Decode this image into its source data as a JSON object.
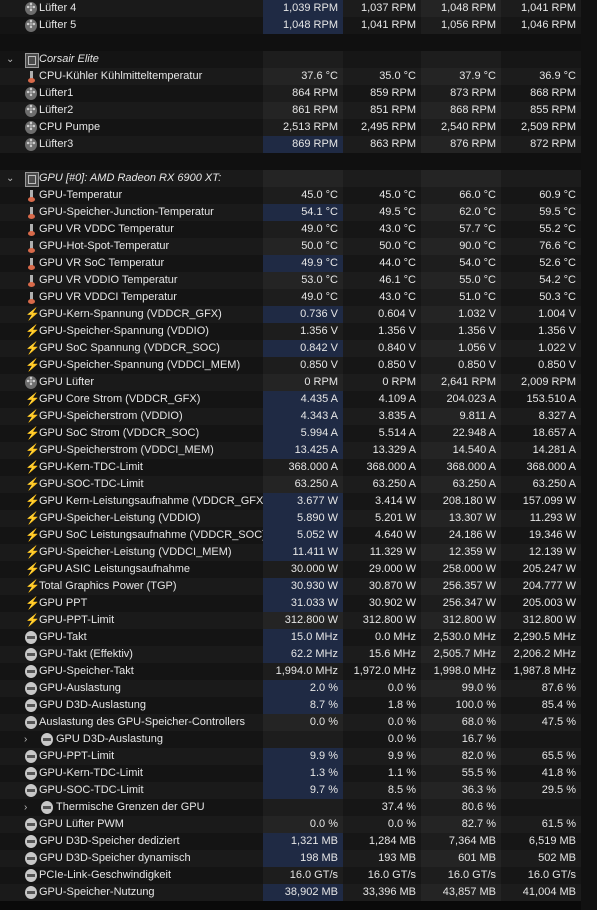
{
  "rows": [
    {
      "kind": "data",
      "icon": "fan-icon",
      "label": "Lüfter 4",
      "v": [
        "1,039 RPM",
        "1,037 RPM",
        "1,048 RPM",
        "1,041 RPM"
      ],
      "hl": true
    },
    {
      "kind": "data",
      "icon": "fan-icon",
      "label": "Lüfter 5",
      "v": [
        "1,048 RPM",
        "1,041 RPM",
        "1,056 RPM",
        "1,046 RPM"
      ],
      "hl": true
    },
    {
      "kind": "empty"
    },
    {
      "kind": "group",
      "icon": "chip-icon",
      "label": "Corsair Elite"
    },
    {
      "kind": "data",
      "icon": "thermometer-icon",
      "label": "CPU-Kühler Kühlmitteltemperatur",
      "v": [
        "37.6 °C",
        "35.0 °C",
        "37.9 °C",
        "36.9 °C"
      ]
    },
    {
      "kind": "data",
      "icon": "fan-icon",
      "label": "Lüfter1",
      "v": [
        "864 RPM",
        "859 RPM",
        "873 RPM",
        "868 RPM"
      ]
    },
    {
      "kind": "data",
      "icon": "fan-icon",
      "label": "Lüfter2",
      "v": [
        "861 RPM",
        "851 RPM",
        "868 RPM",
        "855 RPM"
      ]
    },
    {
      "kind": "data",
      "icon": "fan-icon",
      "label": "CPU Pumpe",
      "v": [
        "2,513 RPM",
        "2,495 RPM",
        "2,540 RPM",
        "2,509 RPM"
      ]
    },
    {
      "kind": "data",
      "icon": "fan-icon",
      "label": "Lüfter3",
      "v": [
        "869 RPM",
        "863 RPM",
        "876 RPM",
        "872 RPM"
      ],
      "hl": true
    },
    {
      "kind": "empty"
    },
    {
      "kind": "group",
      "icon": "chip-icon",
      "label": "GPU [#0]: AMD Radeon RX 6900 XT:"
    },
    {
      "kind": "data",
      "icon": "thermometer-icon",
      "label": "GPU-Temperatur",
      "v": [
        "45.0 °C",
        "45.0 °C",
        "66.0 °C",
        "60.9 °C"
      ]
    },
    {
      "kind": "data",
      "icon": "thermometer-icon",
      "label": "GPU-Speicher-Junction-Temperatur",
      "v": [
        "54.1 °C",
        "49.5 °C",
        "62.0 °C",
        "59.5 °C"
      ],
      "hl": true
    },
    {
      "kind": "data",
      "icon": "thermometer-icon",
      "label": "GPU VR VDDC Temperatur",
      "v": [
        "49.0 °C",
        "43.0 °C",
        "57.7 °C",
        "55.2 °C"
      ]
    },
    {
      "kind": "data",
      "icon": "thermometer-icon",
      "label": "GPU-Hot-Spot-Temperatur",
      "v": [
        "50.0 °C",
        "50.0 °C",
        "90.0 °C",
        "76.6 °C"
      ]
    },
    {
      "kind": "data",
      "icon": "thermometer-icon",
      "label": "GPU VR SoC Temperatur",
      "v": [
        "49.9 °C",
        "44.0 °C",
        "54.0 °C",
        "52.6 °C"
      ],
      "hl": true
    },
    {
      "kind": "data",
      "icon": "thermometer-icon",
      "label": "GPU VR VDDIO Temperatur",
      "v": [
        "53.0 °C",
        "46.1 °C",
        "55.0 °C",
        "54.2 °C"
      ]
    },
    {
      "kind": "data",
      "icon": "thermometer-icon",
      "label": "GPU VR VDDCI Temperatur",
      "v": [
        "49.0 °C",
        "43.0 °C",
        "51.0 °C",
        "50.3 °C"
      ]
    },
    {
      "kind": "data",
      "icon": "bolt-icon",
      "label": "GPU-Kern-Spannung (VDDCR_GFX)",
      "v": [
        "0.736 V",
        "0.604 V",
        "1.032 V",
        "1.004 V"
      ],
      "hl": true
    },
    {
      "kind": "data",
      "icon": "bolt-icon",
      "label": "GPU-Speicher-Spannung (VDDIO)",
      "v": [
        "1.356 V",
        "1.356 V",
        "1.356 V",
        "1.356 V"
      ]
    },
    {
      "kind": "data",
      "icon": "bolt-icon",
      "label": "GPU SoC Spannung (VDDCR_SOC)",
      "v": [
        "0.842 V",
        "0.840 V",
        "1.056 V",
        "1.022 V"
      ],
      "hl": true
    },
    {
      "kind": "data",
      "icon": "bolt-icon",
      "label": "GPU-Speicher-Spannung (VDDCI_MEM)",
      "v": [
        "0.850 V",
        "0.850 V",
        "0.850 V",
        "0.850 V"
      ]
    },
    {
      "kind": "data",
      "icon": "fan-icon",
      "label": "GPU Lüfter",
      "v": [
        "0 RPM",
        "0 RPM",
        "2,641 RPM",
        "2,009 RPM"
      ]
    },
    {
      "kind": "data",
      "icon": "bolt-icon",
      "label": "GPU Core Strom (VDDCR_GFX)",
      "v": [
        "4.435 A",
        "4.109 A",
        "204.023 A",
        "153.510 A"
      ],
      "hl": true
    },
    {
      "kind": "data",
      "icon": "bolt-icon",
      "label": "GPU-Speicherstrom (VDDIO)",
      "v": [
        "4.343 A",
        "3.835 A",
        "9.811 A",
        "8.327 A"
      ],
      "hl": true
    },
    {
      "kind": "data",
      "icon": "bolt-icon",
      "label": "GPU SoC Strom (VDDCR_SOC)",
      "v": [
        "5.994 A",
        "5.514 A",
        "22.948 A",
        "18.657 A"
      ],
      "hl": true
    },
    {
      "kind": "data",
      "icon": "bolt-icon",
      "label": "GPU-Speicherstrom (VDDCI_MEM)",
      "v": [
        "13.425 A",
        "13.329 A",
        "14.540 A",
        "14.281 A"
      ],
      "hl": true
    },
    {
      "kind": "data",
      "icon": "bolt-icon",
      "label": "GPU-Kern-TDC-Limit",
      "v": [
        "368.000 A",
        "368.000 A",
        "368.000 A",
        "368.000 A"
      ]
    },
    {
      "kind": "data",
      "icon": "bolt-icon",
      "label": "GPU-SOC-TDC-Limit",
      "v": [
        "63.250 A",
        "63.250 A",
        "63.250 A",
        "63.250 A"
      ]
    },
    {
      "kind": "data",
      "icon": "bolt-icon",
      "label": "GPU Kern-Leistungsaufnahme (VDDCR_GFX)",
      "v": [
        "3.677 W",
        "3.414 W",
        "208.180 W",
        "157.099 W"
      ],
      "hl": true
    },
    {
      "kind": "data",
      "icon": "bolt-icon",
      "label": "GPU-Speicher-Leistung (VDDIO)",
      "v": [
        "5.890 W",
        "5.201 W",
        "13.307 W",
        "11.293 W"
      ],
      "hl": true
    },
    {
      "kind": "data",
      "icon": "bolt-icon",
      "label": "GPU SoC Leistungsaufnahme (VDDCR_SOC)",
      "v": [
        "5.052 W",
        "4.640 W",
        "24.186 W",
        "19.346 W"
      ],
      "hl": true
    },
    {
      "kind": "data",
      "icon": "bolt-icon",
      "label": "GPU-Speicher-Leistung (VDDCI_MEM)",
      "v": [
        "11.411 W",
        "11.329 W",
        "12.359 W",
        "12.139 W"
      ],
      "hl": true
    },
    {
      "kind": "data",
      "icon": "bolt-icon",
      "label": "GPU ASIC Leistungsaufnahme",
      "v": [
        "30.000 W",
        "29.000 W",
        "258.000 W",
        "205.247 W"
      ]
    },
    {
      "kind": "data",
      "icon": "bolt-icon",
      "label": "Total Graphics Power (TGP)",
      "v": [
        "30.930 W",
        "30.870 W",
        "256.357 W",
        "204.777 W"
      ],
      "hl": true
    },
    {
      "kind": "data",
      "icon": "bolt-icon",
      "label": "GPU PPT",
      "v": [
        "31.033 W",
        "30.902 W",
        "256.347 W",
        "205.003 W"
      ],
      "hl": true
    },
    {
      "kind": "data",
      "icon": "bolt-icon",
      "label": "GPU-PPT-Limit",
      "v": [
        "312.800 W",
        "312.800 W",
        "312.800 W",
        "312.800 W"
      ]
    },
    {
      "kind": "data",
      "icon": "clock-icon",
      "label": "GPU-Takt",
      "v": [
        "15.0 MHz",
        "0.0 MHz",
        "2,530.0 MHz",
        "2,290.5 MHz"
      ],
      "hl": true
    },
    {
      "kind": "data",
      "icon": "clock-icon",
      "label": "GPU-Takt (Effektiv)",
      "v": [
        "62.2 MHz",
        "15.6 MHz",
        "2,505.7 MHz",
        "2,206.2 MHz"
      ],
      "hl": true
    },
    {
      "kind": "data",
      "icon": "clock-icon",
      "label": "GPU-Speicher-Takt",
      "v": [
        "1,994.0 MHz",
        "1,972.0 MHz",
        "1,998.0 MHz",
        "1,987.8 MHz"
      ]
    },
    {
      "kind": "data",
      "icon": "clock-icon",
      "label": "GPU-Auslastung",
      "v": [
        "2.0 %",
        "0.0 %",
        "99.0 %",
        "87.6 %"
      ],
      "hl": true
    },
    {
      "kind": "data",
      "icon": "clock-icon",
      "label": "GPU D3D-Auslastung",
      "v": [
        "8.7 %",
        "1.8 %",
        "100.0 %",
        "85.4 %"
      ],
      "hl": true
    },
    {
      "kind": "data",
      "icon": "clock-icon",
      "label": "Auslastung des GPU-Speicher-Controllers",
      "v": [
        "0.0 %",
        "0.0 %",
        "68.0 %",
        "47.5 %"
      ]
    },
    {
      "kind": "sub",
      "icon": "clock-icon",
      "label": "GPU D3D-Auslastung",
      "v": [
        "",
        "0.0 %",
        "16.7 %",
        ""
      ]
    },
    {
      "kind": "data",
      "icon": "clock-icon",
      "label": "GPU-PPT-Limit",
      "v": [
        "9.9 %",
        "9.9 %",
        "82.0 %",
        "65.5 %"
      ],
      "hl": true
    },
    {
      "kind": "data",
      "icon": "clock-icon",
      "label": "GPU-Kern-TDC-Limit",
      "v": [
        "1.3 %",
        "1.1 %",
        "55.5 %",
        "41.8 %"
      ],
      "hl": true
    },
    {
      "kind": "data",
      "icon": "clock-icon",
      "label": "GPU-SOC-TDC-Limit",
      "v": [
        "9.7 %",
        "8.5 %",
        "36.3 %",
        "29.5 %"
      ],
      "hl": true
    },
    {
      "kind": "sub",
      "icon": "clock-icon",
      "label": "Thermische Grenzen der GPU",
      "v": [
        "",
        "37.4 %",
        "80.6 %",
        ""
      ]
    },
    {
      "kind": "data",
      "icon": "clock-icon",
      "label": "GPU Lüfter PWM",
      "v": [
        "0.0 %",
        "0.0 %",
        "82.7 %",
        "61.5 %"
      ]
    },
    {
      "kind": "data",
      "icon": "clock-icon",
      "label": "GPU D3D-Speicher dediziert",
      "v": [
        "1,321 MB",
        "1,284 MB",
        "7,364 MB",
        "6,519 MB"
      ],
      "hl": true
    },
    {
      "kind": "data",
      "icon": "clock-icon",
      "label": "GPU D3D-Speicher dynamisch",
      "v": [
        "198 MB",
        "193 MB",
        "601 MB",
        "502 MB"
      ],
      "hl": true
    },
    {
      "kind": "data",
      "icon": "clock-icon",
      "label": "PCIe-Link-Geschwindigkeit",
      "v": [
        "16.0 GT/s",
        "16.0 GT/s",
        "16.0 GT/s",
        "16.0 GT/s"
      ]
    },
    {
      "kind": "data",
      "icon": "clock-icon",
      "label": "GPU-Speicher-Nutzung",
      "v": [
        "38,902 MB",
        "33,396 MB",
        "43,857 MB",
        "41,004 MB"
      ],
      "hl": true
    }
  ],
  "expand_icon": "⌄",
  "collapsed_icon": "›"
}
